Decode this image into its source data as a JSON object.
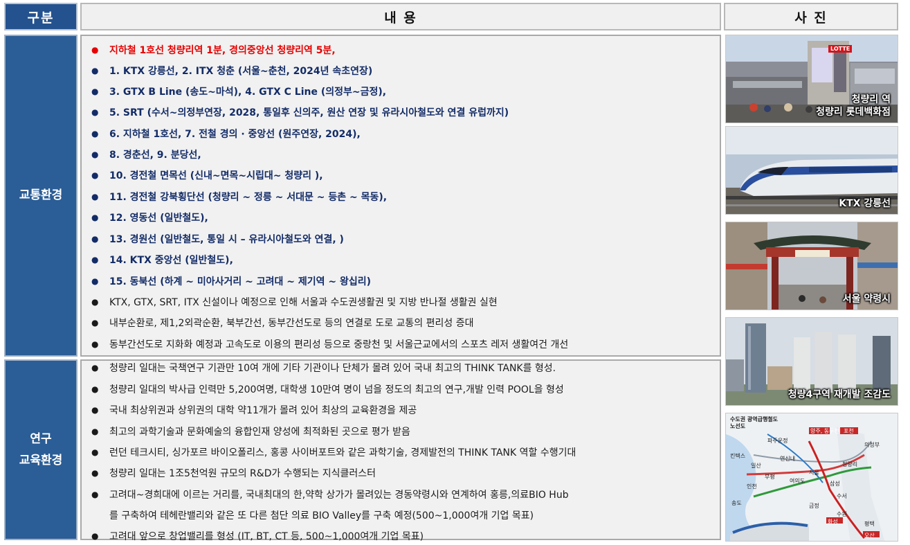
{
  "headers": {
    "category": "구분",
    "content": "내 용",
    "photo": "사 진"
  },
  "transport": {
    "label": "교통환경",
    "items": [
      {
        "text": "지하철 1호선 청량리역 1분, 경의중앙선  청량리역 5분,",
        "style": "red"
      },
      {
        "text": "1. KTX 강릉선,          2. ITX 청춘 (서울~춘천, 2024년 속초연장)",
        "style": "navy"
      },
      {
        "text": "3. GTX B Line (송도~마석),          4. GTX C Line (의정부~금정),",
        "style": "navy"
      },
      {
        "text": "5. SRT (수서~의정부연장, 2028, 통일후 신의주, 원산 연장  및  유라시아철도와 연결 유럽까지)",
        "style": "navy"
      },
      {
        "text": "6. 지하철  1호선,          7. 전철 경의 · 중앙선  (원주연장, 2024),",
        "style": "navy"
      },
      {
        "text": "8. 경춘선,       9. 분당선,",
        "style": "navy"
      },
      {
        "text": "10. 경전철 면목선  (신내~면목~시립대~ 청량리 ),",
        "style": "navy"
      },
      {
        "text": "11. 경전철 강북횡단선 (청량리 ~ 정릉 ~ 서대문 ~ 등촌 ~ 목동),",
        "style": "navy"
      },
      {
        "text": "12. 영동선 (일반철도),",
        "style": "navy"
      },
      {
        "text": "13. 경원선 (일반철도, 통일 시 – 유라시아철도와 연결, )",
        "style": "navy"
      },
      {
        "text": "14. KTX 중앙선 (일반철도),",
        "style": "navy"
      },
      {
        "text": "15. 동북선 (하계 ~ 미아사거리 ~ 고려대 ~ 제기역 ~ 왕십리)",
        "style": "navy"
      },
      {
        "text": "KTX, GTX, SRT, ITX 신설이나 예정으로 인해 서울과 수도권생활권 및 지방 반나절 생활권 실현",
        "style": "plain"
      },
      {
        "text": "내부순환로, 제1,2외곽순환, 북부간선, 동부간선도로 등의 연결로 도로 교통의 편리성 증대",
        "style": "plain"
      },
      {
        "text": "동부간선도로 지화화 예정과 고속도로 이용의 편리성 등으로 중랑천 및 서울근교에서의 스포츠 레저 생활여건 개선",
        "style": "plain"
      }
    ]
  },
  "research": {
    "label_line1": "연구",
    "label_line2": "교육환경",
    "items": [
      {
        "text": "청량리 일대는 국책연구 기관만 10여 개에 기타 기관이나 단체가 몰려 있어 국내 최고의 THINK TANK를 형성."
      },
      {
        "text": "청량리 일대의 박사급 인력만 5,200여명, 대학생 10만여 명이 넘을 정도의 최고의 연구,개발 인력 POOL을 형성"
      },
      {
        "text": "국내 최상위권과 상위권의 대학 약11개가 몰려 있어 최상의 교육환경을 제공"
      },
      {
        "text": "최고의 과학기술과 문화예술의 융합인재 양성에 최적화된 곳으로 평가 받음"
      },
      {
        "text": "런던 테크시티, 싱가포르 바이오폴리스, 홍콩 사이버포트와 같은 과학기술, 경제발전의 THINK TANK 역할 수행기대"
      },
      {
        "text": "청량리 일대는 1조5천억원 규모의 R&D가 수행되는 지식클러스터"
      },
      {
        "text": "고려대~경희대에 이르는 거리를, 국내최대의 한,약학 상가가 몰려있는 경동약령시와 연계하여 홍릉,의료BIO Hub"
      },
      {
        "text": "를 구축하여 테헤란밸리와 같은 또 다른 첨단 의료 BIO Valley를 구축 예정(500~1,000여개 기업 목표)",
        "continuation": true
      },
      {
        "text": "고려대 앞으로 창업밸리를 형성 (IT, BT, CT 등, 500~1,000여개 기업 목표)"
      }
    ]
  },
  "photos": [
    {
      "icon": "station-building-photo",
      "caption_line1": "청량리 역",
      "caption_line2": "청량리 롯데백화점",
      "sign_text": "LOTTE"
    },
    {
      "icon": "ktx-train-photo",
      "caption_line1": "KTX 강릉선"
    },
    {
      "icon": "seoul-yangnyeongsi-gate-photo",
      "caption_line1": "서울 약령시"
    },
    {
      "icon": "redevelopment-towers-photo",
      "caption_line1": "청량4구역 재개발 조감도"
    }
  ],
  "map": {
    "title_line1": "수도권 광역급행철도",
    "title_line2": "노선도",
    "labels": [
      "양주, 동두천",
      "포천",
      "파주운정",
      "의정부",
      "킨텍스",
      "일산",
      "연신내",
      "서울",
      "청량리",
      "삼성",
      "수서",
      "여의도",
      "송도",
      "인천",
      "금정",
      "수원",
      "부평",
      "평택",
      "화성",
      "오산"
    ]
  },
  "colors": {
    "header_dark": "#24528f",
    "category_bg": "#2b5d96",
    "accent_red": "#e60000",
    "text_navy": "#132c67",
    "panel_bg": "#f1f1f1"
  }
}
